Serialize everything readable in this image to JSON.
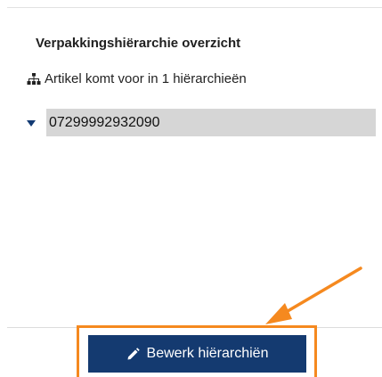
{
  "panel": {
    "title": "Verpakkingshiërarchie overzicht",
    "info_icon": "sitemap-icon",
    "info_text": "Artikel komt voor in 1 hiërarchieën",
    "tree": [
      {
        "label": "07299992932090",
        "expanded": true
      }
    ]
  },
  "footer": {
    "edit_button_label": "Bewerk hiërarchiën",
    "edit_button_icon": "pencil-icon"
  },
  "annotation": {
    "highlight_color": "#f5891f",
    "arrow_icon": "arrow-annotation"
  },
  "colors": {
    "primary": "#143a70",
    "selected_bg": "#d6d6d6"
  }
}
